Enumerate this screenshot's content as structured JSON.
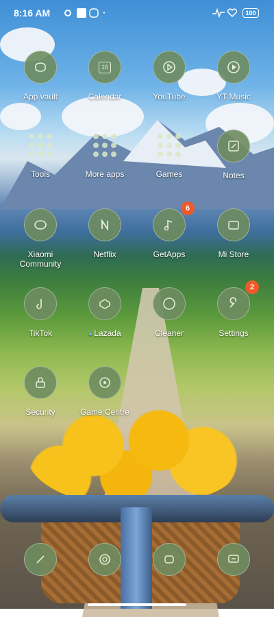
{
  "status_bar": {
    "time": "8:16 AM",
    "battery": "100"
  },
  "apps": [
    {
      "name": "App vault"
    },
    {
      "name": "Calendar",
      "icon_text": "16"
    },
    {
      "name": "YouTube"
    },
    {
      "name": "YT Music"
    },
    {
      "name": "Tools"
    },
    {
      "name": "More apps"
    },
    {
      "name": "Games"
    },
    {
      "name": "Notes"
    },
    {
      "name": "Xiaomi Community"
    },
    {
      "name": "Netflix"
    },
    {
      "name": "GetApps",
      "badge": "6"
    },
    {
      "name": "Mi Store"
    },
    {
      "name": "TikTok"
    },
    {
      "name": "Lazada"
    },
    {
      "name": "Cleaner"
    },
    {
      "name": "Settings",
      "badge": "2"
    },
    {
      "name": "Security"
    },
    {
      "name": "Game Centre"
    }
  ],
  "dock": [
    {
      "name": "phone-icon"
    },
    {
      "name": "camera-icon"
    },
    {
      "name": "gallery-icon"
    },
    {
      "name": "messages-icon"
    }
  ]
}
